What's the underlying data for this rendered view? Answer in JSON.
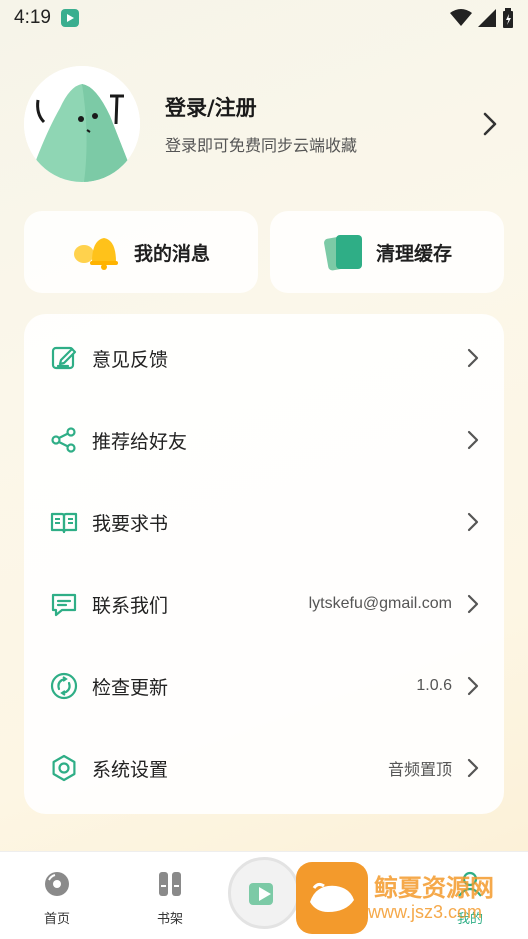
{
  "status_bar": {
    "time": "4:19"
  },
  "profile": {
    "title": "登录/注册",
    "subtitle": "登录即可免费同步云端收藏"
  },
  "quick_actions": [
    {
      "label": "我的消息",
      "icon": "bell-icon"
    },
    {
      "label": "清理缓存",
      "icon": "cards-icon"
    }
  ],
  "menu": [
    {
      "label": "意见反馈",
      "value": "",
      "icon": "edit-icon"
    },
    {
      "label": "推荐给好友",
      "value": "",
      "icon": "share-icon"
    },
    {
      "label": "我要求书",
      "value": "",
      "icon": "book-icon"
    },
    {
      "label": "联系我们",
      "value": "lytskefu@gmail.com",
      "icon": "message-icon"
    },
    {
      "label": "检查更新",
      "value": "1.0.6",
      "icon": "refresh-icon"
    },
    {
      "label": "系统设置",
      "value": "音频置顶",
      "icon": "settings-icon"
    }
  ],
  "tabbar": {
    "tabs": [
      {
        "label": "首页",
        "icon": "disc-icon"
      },
      {
        "label": "书架",
        "icon": "bookshelf-icon"
      },
      {
        "label": "我的",
        "icon": "user-icon",
        "active": true
      }
    ]
  },
  "watermark": {
    "name": "鲸夏资源网",
    "url": "www.jsz3.com"
  },
  "colors": {
    "accent": "#2fae86",
    "brand_green": "#3aae8f"
  }
}
